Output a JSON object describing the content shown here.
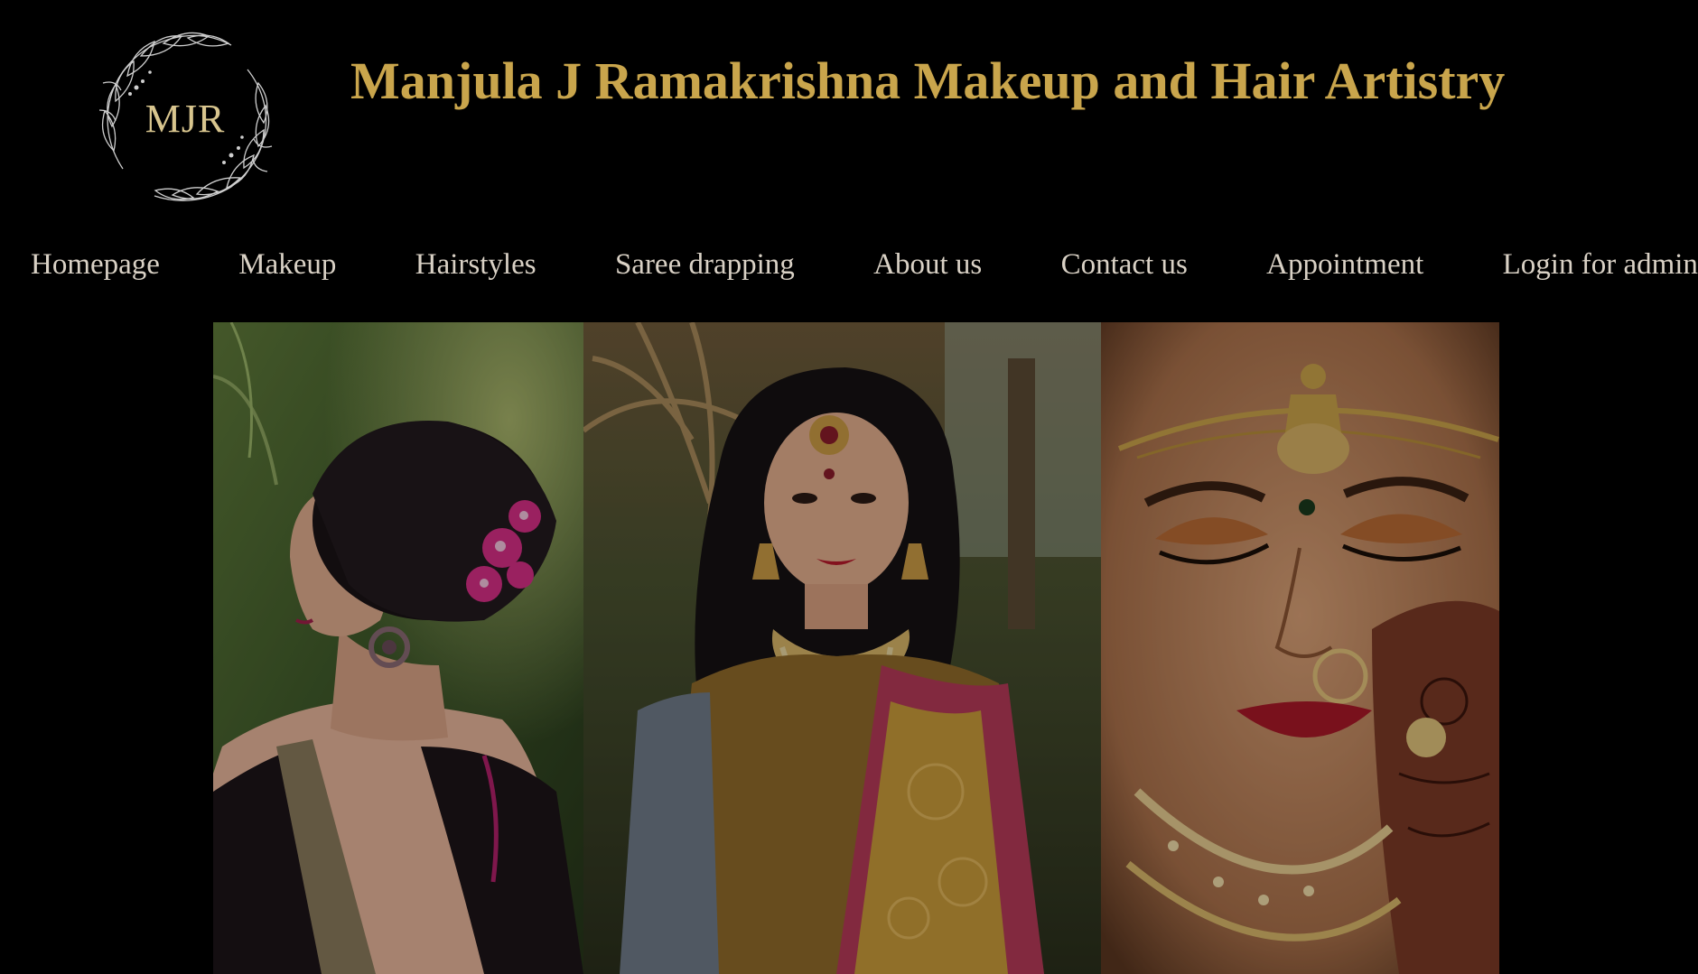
{
  "header": {
    "logo_text": "MJR",
    "title": "Manjula J Ramakrishna Makeup and Hair Artistry"
  },
  "nav": {
    "items": [
      {
        "label": "Homepage"
      },
      {
        "label": "Makeup"
      },
      {
        "label": "Hairstyles"
      },
      {
        "label": "Saree drapping"
      },
      {
        "label": "About us"
      },
      {
        "label": "Contact us"
      },
      {
        "label": "Appointment"
      },
      {
        "label": "Login for admin"
      }
    ]
  },
  "gallery": {
    "photos": [
      {
        "subject": "bride-side-profile-hair-bun-flowers"
      },
      {
        "subject": "bride-silk-saree-temple-jewellery"
      },
      {
        "subject": "bride-closeup-eye-makeup-nose-ring"
      }
    ]
  },
  "colors": {
    "background": "#000000",
    "title_gold": "#c9a54c",
    "logo_text": "#d8c58e",
    "nav_text": "#d9d1c5"
  },
  "icons": {
    "logo": "leaf-wreath-icon"
  }
}
